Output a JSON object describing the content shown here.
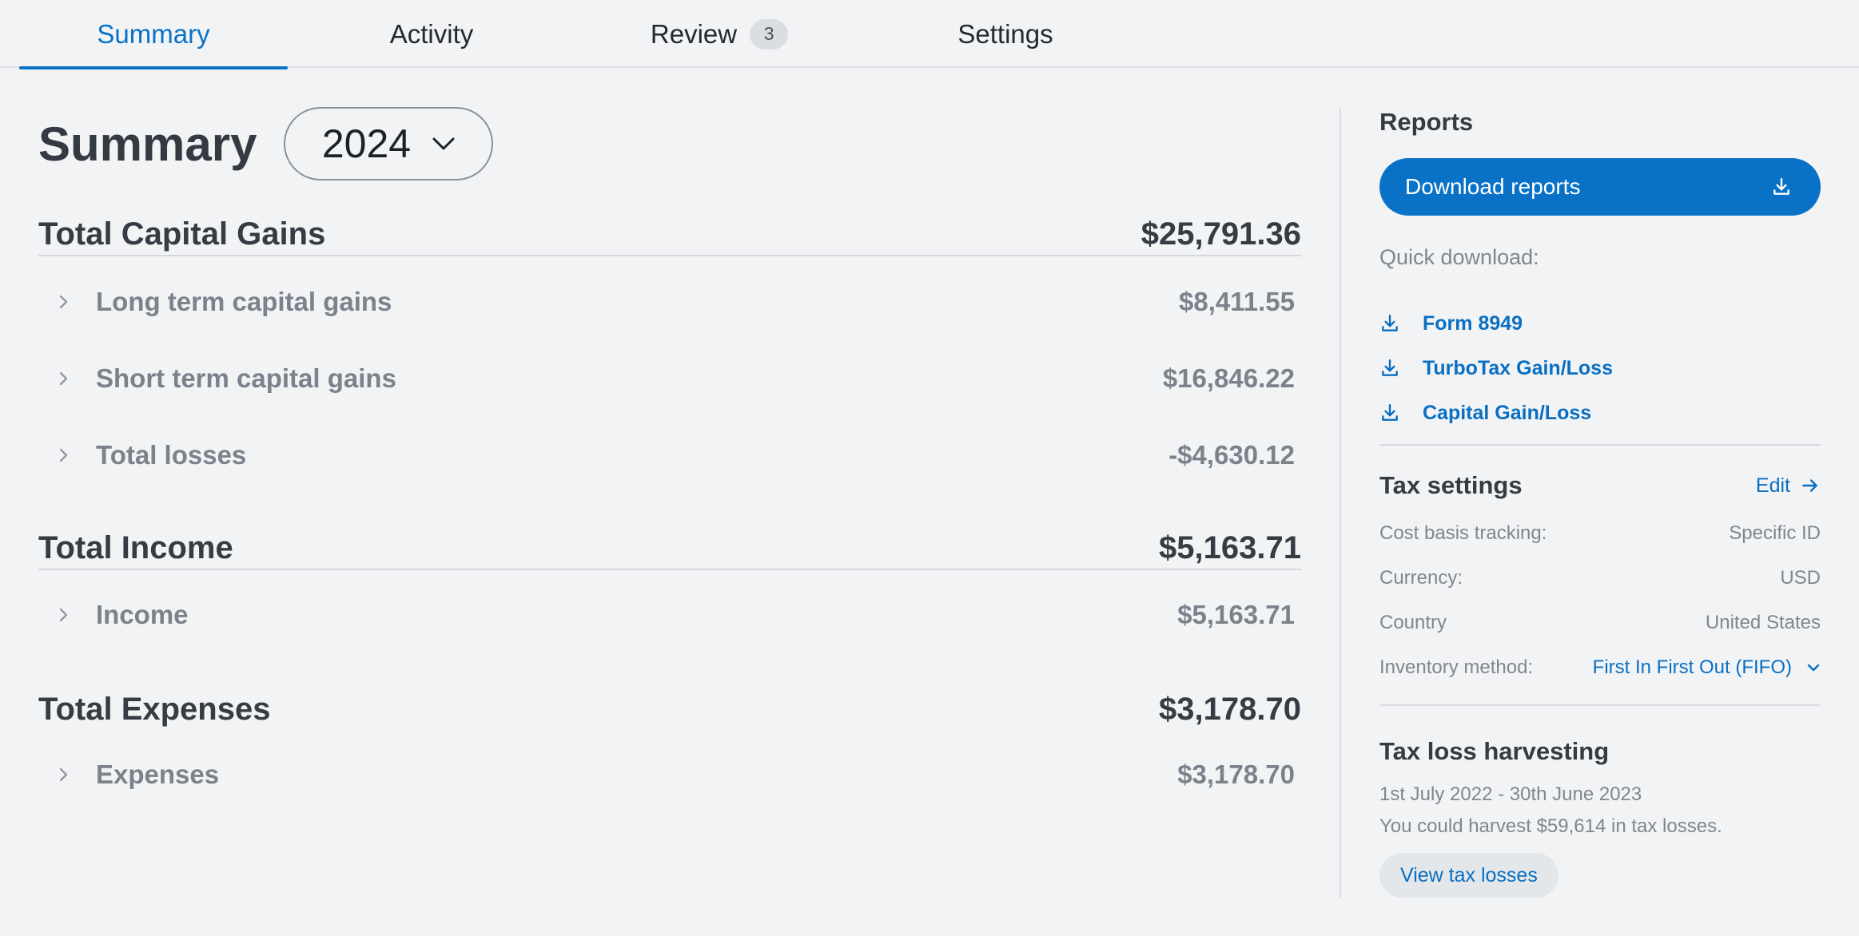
{
  "tabs": [
    {
      "label": "Summary",
      "active": true
    },
    {
      "label": "Activity"
    },
    {
      "label": "Review",
      "badge": "3"
    },
    {
      "label": "Settings"
    }
  ],
  "summary": {
    "title": "Summary",
    "year": "2024",
    "capital_gains": {
      "label": "Total Capital Gains",
      "value": "$25,791.36",
      "rows": [
        {
          "label": "Long term capital gains",
          "value": "$8,411.55"
        },
        {
          "label": "Short term capital gains",
          "value": "$16,846.22"
        },
        {
          "label": "Total losses",
          "value": "-$4,630.12"
        }
      ]
    },
    "income": {
      "label": "Total Income",
      "value": "$5,163.71",
      "rows": [
        {
          "label": "Income",
          "value": "$5,163.71"
        }
      ]
    },
    "expenses": {
      "label": "Total Expenses",
      "value": "$3,178.70",
      "rows": [
        {
          "label": "Expenses",
          "value": "$3,178.70"
        }
      ]
    }
  },
  "reports": {
    "title": "Reports",
    "download_label": "Download reports",
    "quick_label": "Quick download:",
    "quick_links": [
      "Form 8949",
      "TurboTax Gain/Loss",
      "Capital Gain/Loss"
    ]
  },
  "tax_settings": {
    "title": "Tax settings",
    "edit_label": "Edit",
    "items": [
      {
        "label": "Cost basis tracking:",
        "value": "Specific ID"
      },
      {
        "label": "Currency:",
        "value": "USD"
      },
      {
        "label": "Country",
        "value": "United States"
      },
      {
        "label": "Inventory method:",
        "value": "First In First Out (FIFO)"
      }
    ]
  },
  "tax_loss": {
    "title": "Tax loss harvesting",
    "period": "1st July 2022 - 30th June 2023",
    "message": "You could harvest $59,614 in tax losses.",
    "button": "View tax losses"
  },
  "colors": {
    "accent": "#0a72c6",
    "background": "#f2f3f5"
  }
}
